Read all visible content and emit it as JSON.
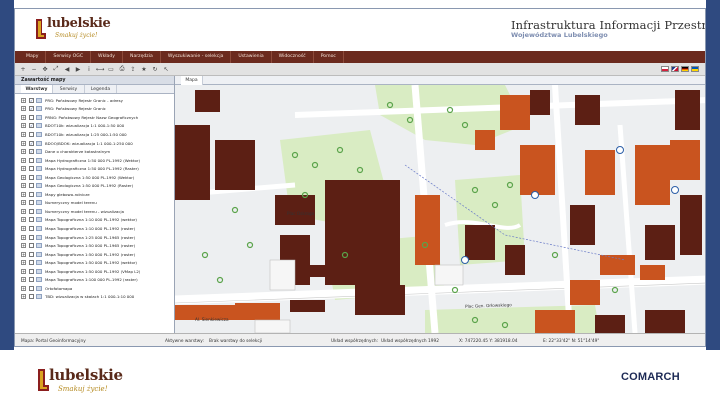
{
  "brand": {
    "logo_text": "lubelskie",
    "logo_tagline": "Smakuj życie!",
    "footer_logo_text": "lubelskie",
    "footer_tagline": "Smakuj życie!",
    "partner": "COMARCH"
  },
  "header": {
    "title": "Infrastruktura Informacji Przestrzennej",
    "subtitle": "Województwa Lubelskiego"
  },
  "menu": [
    {
      "label": "Mapy"
    },
    {
      "label": "Serwisy OGC"
    },
    {
      "label": "Wkłady"
    },
    {
      "label": "Narzędzia"
    },
    {
      "label": "Wyszukiwanie - selekcja"
    },
    {
      "label": "Ustawienia"
    },
    {
      "label": "Widoczność"
    },
    {
      "label": "Pomoc"
    }
  ],
  "toolbar": {
    "tools": [
      "zoom-in-icon",
      "zoom-out-icon",
      "pan-icon",
      "full-extent-icon",
      "previous-view-icon",
      "next-view-icon",
      "info-icon",
      "measure-icon",
      "select-icon",
      "print-icon",
      "export-icon",
      "bookmark-icon",
      "refresh-icon",
      "cursor-icon"
    ],
    "flags": [
      "pl-flag-icon",
      "en-flag-icon",
      "de-flag-icon",
      "ua-flag-icon"
    ]
  },
  "panel": {
    "title": "Zawartość mapy",
    "tabs": [
      "Warstwy",
      "Serwisy",
      "Legenda"
    ],
    "active_tab": "Warstwy",
    "layers": [
      {
        "label": "PRG: Państwowy Rejestr Granic - adresy",
        "checked": true
      },
      {
        "label": "PRG: Państwowy Rejestr Granic",
        "checked": true
      },
      {
        "label": "PRNG: Państwowy Rejestr Nazw Geograficznych",
        "checked": false
      },
      {
        "label": "BDOT10k: wizualizacja 1:1 000-1:50 000",
        "checked": true
      },
      {
        "label": "BDOT10k: wizualizacja 1:25 000-1:50 000",
        "checked": false
      },
      {
        "label": "BDOO/BDOK: wizualizacja 1:1 000-1:250 000",
        "checked": true
      },
      {
        "label": "Dane o charakterze katastralnym",
        "checked": true
      },
      {
        "label": "Mapa Hydrograficzna 1:50 000 PL-1992 (Wektor)",
        "checked": false
      },
      {
        "label": "Mapa Hydrograficzna 1:50 000 PL-1992 (Raster)",
        "checked": false
      },
      {
        "label": "Mapa Geologiczna 1:50 000 PL-1992 (Wektor)",
        "checked": false
      },
      {
        "label": "Mapa Geologiczna 1:50 000 PL-1992 (Raster)",
        "checked": false
      },
      {
        "label": "Mapy glebowo-rolnicze",
        "checked": false
      },
      {
        "label": "Numeryczny model terenu",
        "checked": false
      },
      {
        "label": "Numeryczny model terenu - wizualizacja",
        "checked": false
      },
      {
        "label": "Mapa Topograficzna 1:10 000 PL-1992 (wektor)",
        "checked": false
      },
      {
        "label": "Mapa Topograficzna 1:10 000 PL-1992 (raster)",
        "checked": false
      },
      {
        "label": "Mapa Topograficzna 1:25 000 PL-1965 (raster)",
        "checked": false
      },
      {
        "label": "Mapa Topograficzna 1:50 000 PL-1965 (raster)",
        "checked": false
      },
      {
        "label": "Mapa Topograficzna 1:50 000 PL-1992 (raster)",
        "checked": false
      },
      {
        "label": "Mapa Topograficzna 1:50 000 PL-1992 (wektor)",
        "checked": false
      },
      {
        "label": "Mapa Topograficzna 1:50 000 PL-1992 (VMap L2)",
        "checked": false
      },
      {
        "label": "Mapa Topograficzna 1:100 000 PL-1992 (raster)",
        "checked": false
      },
      {
        "label": "Ortofotomapa",
        "checked": false
      },
      {
        "label": "TBD: wizualizacja w skalach 1:1 000-1:10 000",
        "checked": false
      }
    ]
  },
  "map": {
    "tab_label": "Mapa",
    "street_labels": [
      "Plac Oskrogo",
      "Plac Gen. Orłowskiego",
      "Al. Sienkiewicza"
    ]
  },
  "status": {
    "portal": "Mapa: Portal Geoinformacyjny",
    "action": "Aktywne warstwy:",
    "action_value": "Brak warstwy do selekcji",
    "view": "Układ współrzędnych:",
    "view_value": "Układ współrzędnych 1992",
    "coords_xy": "X: 747220.45 Y: 381918.04",
    "coords_deg": "E: 22°33'42\" N: 51°14'49\""
  },
  "colors": {
    "frame": "#2f4a80",
    "menubar": "#6b2a1e",
    "building_dark": "#5c1f14",
    "building_orange": "#c9541f",
    "park_green": "#d9ecc3",
    "street": "#ffffff"
  }
}
